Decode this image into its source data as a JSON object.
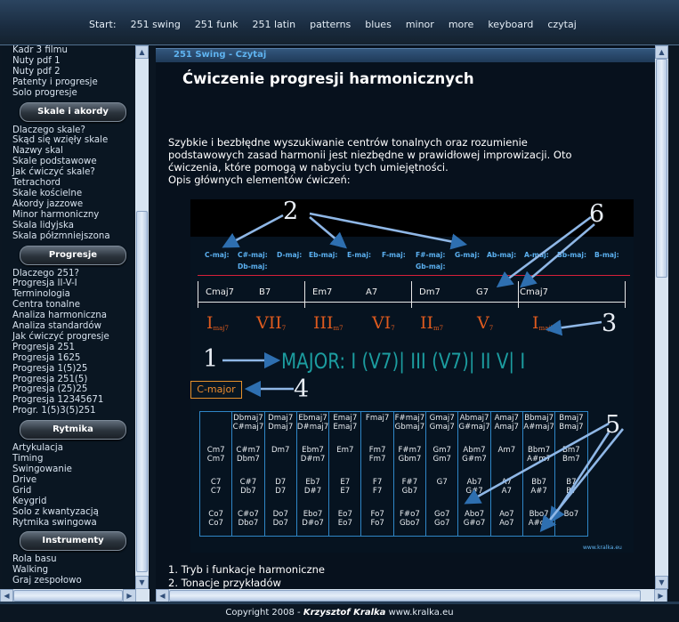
{
  "nav": {
    "start_label": "Start:",
    "items": [
      "251 swing",
      "251 funk",
      "251 latin",
      "patterns",
      "blues",
      "minor",
      "more",
      "keyboard",
      "czytaj"
    ]
  },
  "sidebar": {
    "group0": [
      "Kadr 3 filmu",
      "Nuty pdf 1",
      "Nuty pdf 2",
      "Patenty i progresje",
      "Solo progresje"
    ],
    "header1": "Skale i akordy",
    "group1": [
      "Dlaczego skale?",
      "Skąd się wzięły skale",
      "Nazwy skal",
      "Skale podstawowe",
      "Jak ćwiczyć skale?",
      "Tetrachord",
      "Skale kościelne",
      "Akordy jazzowe",
      "Minor harmoniczny",
      "Skala lidyjska",
      "Skala półzmniejszona"
    ],
    "header2": "Progresje",
    "group2": [
      "Dlaczego 251?",
      "Progresja II-V-I",
      "Terminologia",
      "Centra tonalne",
      "Analiza harmoniczna",
      "Analiza standardów",
      "Jak ćwiczyć progresje",
      "Progresja 251",
      "Progresja 1625",
      "Progresja 1(5)25",
      "Progresja 251(5)",
      "Progresja (25)25",
      "Progresja 12345671",
      "Progr. 1(5)3(5)251"
    ],
    "header3": "Rytmika",
    "group3": [
      "Artykulacja",
      "Timing",
      "Swingowanie",
      "Drive",
      "Grid",
      "Keygrid",
      "Solo z kwantyzacją",
      "Rytmika swingowa"
    ],
    "header4": "Instrumenty",
    "group4": [
      "Rola basu",
      "Walking",
      "Graj zespołowo"
    ]
  },
  "main": {
    "breadcrumb": "251 Swing - Czytaj",
    "title": "Ćwiczenie progresji harmonicznych",
    "intro_lines": [
      "Szybkie i bezbłędne wyszukiwanie centrów tonalnych oraz rozumienie",
      "podstawowych zasad harmonii jest niezbędne w prawidłowej improwizacji. Oto",
      "ćwiczenia, które pomogą w nabyciu tych umiejętności.",
      "Opis głównych elementów ćwiczeń:"
    ],
    "list": [
      "1. Tryb i funkacje harmoniczne",
      "2. Tonacje przykładów"
    ]
  },
  "figure": {
    "numbers": [
      "2",
      "6",
      "3",
      "1",
      "4",
      "5"
    ],
    "keys": [
      "C-maj:",
      "C#-maj:",
      "Db-maj:",
      "D-maj:",
      "Eb-maj:",
      "E-maj:",
      "F-maj:",
      "F#-maj:",
      "Gb-maj:",
      "G-maj:",
      "Ab-maj:",
      "A-maj:",
      "Bb-maj:",
      "B-maj:"
    ],
    "chords": [
      "Cmaj7",
      "B7",
      "Em7",
      "A7",
      "Dm7",
      "G7",
      "Cmaj7"
    ],
    "roman": [
      {
        "num": "I",
        "sub": "maj7"
      },
      {
        "num": "VII",
        "sub": "7"
      },
      {
        "num": "III",
        "sub": "m7"
      },
      {
        "num": "VI",
        "sub": "7"
      },
      {
        "num": "II",
        "sub": "m7"
      },
      {
        "num": "V",
        "sub": "7"
      },
      {
        "num": "I",
        "sub": "maj7"
      }
    ],
    "major_line": "MAJOR: I (V7)| III (V7)| II V| I",
    "key_box": "C-major",
    "table": [
      [
        [
          "",
          ""
        ],
        [
          "Cm7",
          "Cm7"
        ],
        [
          "C7",
          "C7"
        ],
        [
          "Co7",
          "Co7"
        ]
      ],
      [
        [
          "Dbmaj7",
          "C#maj7"
        ],
        [
          "C#m7",
          "Dbm7"
        ],
        [
          "C#7",
          "Db7"
        ],
        [
          "C#o7",
          "Dbo7"
        ]
      ],
      [
        [
          "Dmaj7",
          "Dmaj7"
        ],
        [
          "Dm7",
          ""
        ],
        [
          "D7",
          "D7"
        ],
        [
          "Do7",
          "Do7"
        ]
      ],
      [
        [
          "Ebmaj7",
          "D#maj7"
        ],
        [
          "Ebm7",
          "D#m7"
        ],
        [
          "Eb7",
          "D#7"
        ],
        [
          "Ebo7",
          "D#o7"
        ]
      ],
      [
        [
          "Emaj7",
          "Emaj7"
        ],
        [
          "Em7",
          ""
        ],
        [
          "E7",
          "E7"
        ],
        [
          "Eo7",
          "Eo7"
        ]
      ],
      [
        [
          "Fmaj7",
          ""
        ],
        [
          "Fm7",
          "Fm7"
        ],
        [
          "F7",
          "F7"
        ],
        [
          "Fo7",
          "Fo7"
        ]
      ],
      [
        [
          "F#maj7",
          "Gbmaj7"
        ],
        [
          "F#m7",
          "Gbm7"
        ],
        [
          "F#7",
          "Gb7"
        ],
        [
          "F#o7",
          "Gbo7"
        ]
      ],
      [
        [
          "Gmaj7",
          "Gmaj7"
        ],
        [
          "Gm7",
          "Gm7"
        ],
        [
          "G7",
          ""
        ],
        [
          "Go7",
          "Go7"
        ]
      ],
      [
        [
          "Abmaj7",
          "G#maj7"
        ],
        [
          "Abm7",
          "G#m7"
        ],
        [
          "Ab7",
          "G#7"
        ],
        [
          "Abo7",
          "G#o7"
        ]
      ],
      [
        [
          "Amaj7",
          "Amaj7"
        ],
        [
          "Am7",
          ""
        ],
        [
          "A7",
          "A7"
        ],
        [
          "Ao7",
          "Ao7"
        ]
      ],
      [
        [
          "Bbmaj7",
          "A#maj7"
        ],
        [
          "Bbm7",
          "A#m7"
        ],
        [
          "Bb7",
          "A#7"
        ],
        [
          "Bbo7",
          "A#o7"
        ]
      ],
      [
        [
          "Bmaj7",
          "Bmaj7"
        ],
        [
          "Bm7",
          "Bm7"
        ],
        [
          "B7",
          "B7"
        ],
        [
          "Bo7",
          ""
        ]
      ]
    ],
    "watermark": "www.kralka.eu"
  },
  "footer": {
    "prefix": "Copyright 2008 - ",
    "author": "Krzysztof Kralka",
    "site": " www.kralka.eu"
  },
  "colors": {
    "background": "#0b1622",
    "accent": "#5fb3f0",
    "roman": "#dd5a1e",
    "major_text": "#1c9da0",
    "table_border": "#2f86c6"
  }
}
